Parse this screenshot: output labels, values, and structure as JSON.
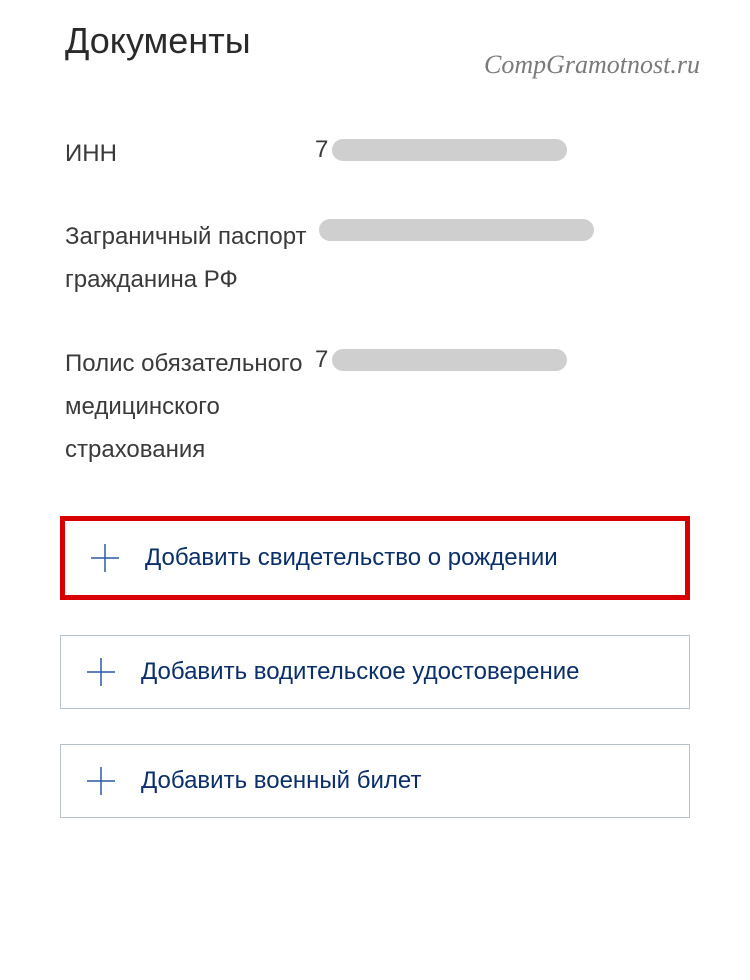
{
  "section": {
    "title": "Документы"
  },
  "watermark": "CompGramotnost.ru",
  "documents": [
    {
      "label": "ИНН",
      "value_prefix": "7"
    },
    {
      "label": "Заграничный паспорт гражданина РФ",
      "value_prefix": ""
    },
    {
      "label": "Полис обязательного медицинского страхования",
      "value_prefix": "7"
    }
  ],
  "add_buttons": [
    {
      "label": "Добавить свидетельство о рождении",
      "highlighted": true
    },
    {
      "label": "Добавить водительское удостоверение",
      "highlighted": false
    },
    {
      "label": "Добавить военный билет",
      "highlighted": false
    }
  ],
  "colors": {
    "primary_text": "#0a2f6a",
    "highlight_border": "#d90000"
  }
}
